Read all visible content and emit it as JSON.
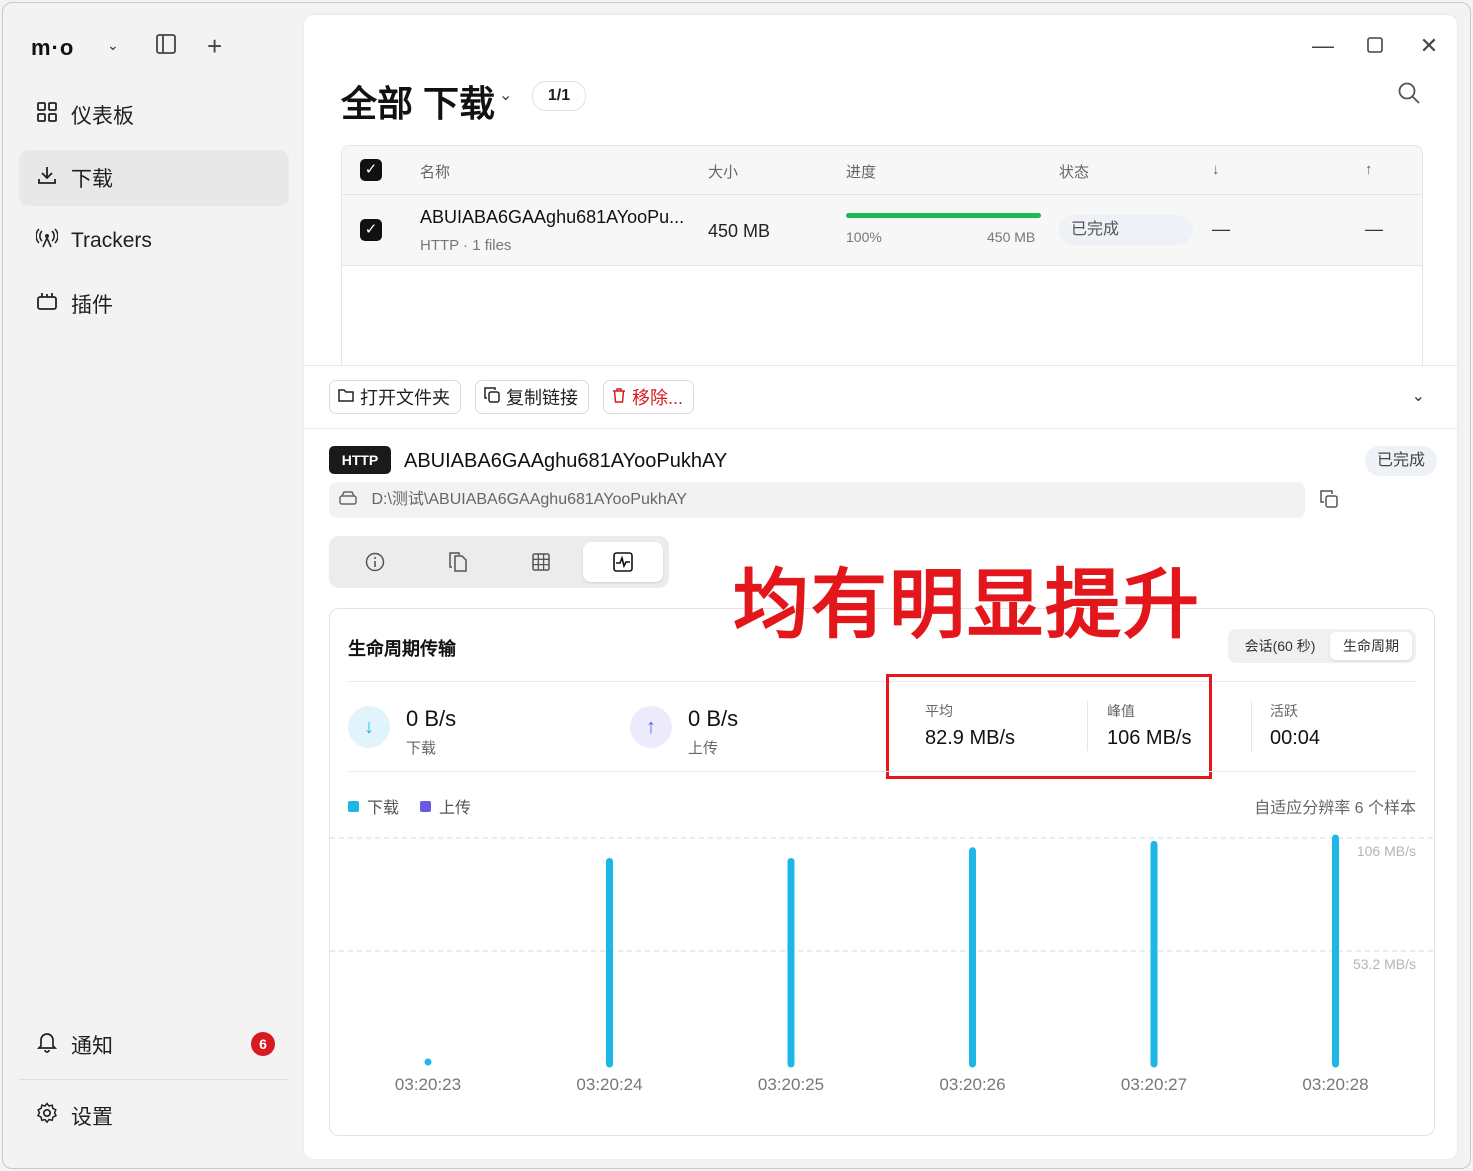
{
  "app": {
    "logo": "m·o"
  },
  "sidebar": {
    "items": [
      {
        "label": "仪表板",
        "icon": "dashboard-icon"
      },
      {
        "label": "下载",
        "icon": "download-icon"
      },
      {
        "label": "Trackers",
        "icon": "antenna-icon"
      },
      {
        "label": "插件",
        "icon": "plugin-icon"
      }
    ],
    "notifications": {
      "label": "通知",
      "count": "6"
    },
    "settings": {
      "label": "设置"
    }
  },
  "header": {
    "title": "全部 下载",
    "count": "1/1"
  },
  "table": {
    "columns": {
      "name": "名称",
      "size": "大小",
      "progress": "进度",
      "status": "状态",
      "down": "↓",
      "up": "↑"
    },
    "row": {
      "name": "ABUIABA6GAAghu681AYooPu...",
      "meta": "HTTP · 1 files",
      "size": "450 MB",
      "progress_pct": "100%",
      "progress_value": 1.0,
      "progress_size": "450 MB",
      "status": "已完成",
      "down": "—",
      "up": "—"
    }
  },
  "detail": {
    "actions": {
      "open_folder": "打开文件夹",
      "copy_link": "复制链接",
      "remove": "移除..."
    },
    "protocol": "HTTP",
    "name": "ABUIABA6GAAghu681AYooPukhAY",
    "status": "已完成",
    "path": "D:\\测试\\ABUIABA6GAAghu681AYooPukhAY",
    "tabs": [
      "info-icon",
      "files-icon",
      "grid-icon",
      "activity-icon"
    ]
  },
  "overlay": "均有明显提升",
  "transfer": {
    "title": "生命周期传输",
    "segments": {
      "session": "会话(60 秒)",
      "lifetime": "生命周期"
    },
    "download": {
      "rate": "0 B/s",
      "label": "下载"
    },
    "upload": {
      "rate": "0 B/s",
      "label": "上传"
    },
    "avg": {
      "label": "平均",
      "value": "82.9 MB/s"
    },
    "peak": {
      "label": "峰值",
      "value": "106 MB/s"
    },
    "active": {
      "label": "活跃",
      "value": "00:04"
    },
    "legend": {
      "download": "下载",
      "upload": "上传"
    },
    "samples": "自适应分辨率 6 个样本"
  },
  "colors": {
    "download": "#1eb6e6",
    "upload": "#6a5ae0",
    "accent_red": "#e3161b",
    "done_green": "#1db954"
  },
  "chart_data": {
    "type": "bar",
    "categories": [
      "03:20:23",
      "03:20:24",
      "03:20:25",
      "03:20:26",
      "03:20:27",
      "03:20:28"
    ],
    "series": [
      {
        "name": "下载",
        "values": [
          0,
          95,
          95,
          100,
          103,
          106
        ]
      }
    ],
    "y_ticks": [
      "106 MB/s",
      "53.2 MB/s"
    ],
    "ylim": [
      0,
      106
    ],
    "grid": true
  }
}
